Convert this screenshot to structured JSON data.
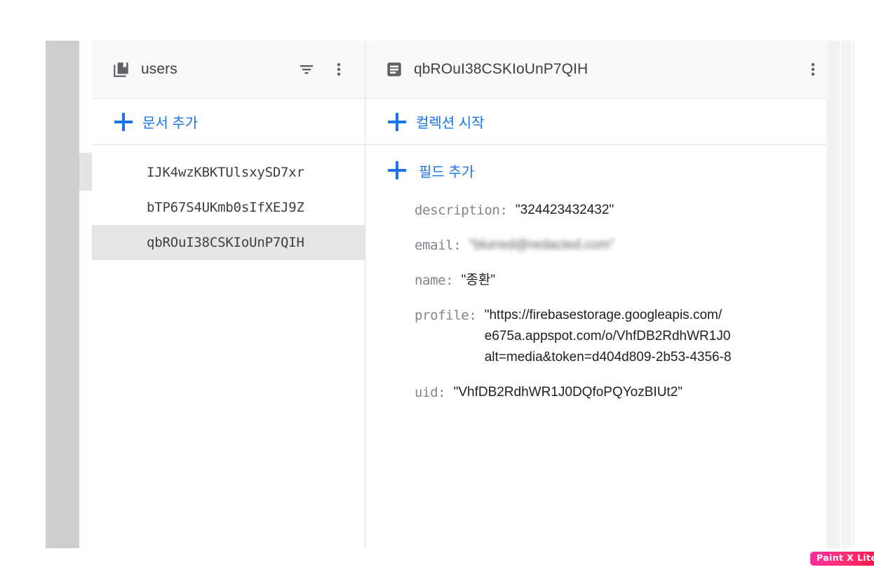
{
  "app": {
    "product": "Firebase Firestore Data Viewer"
  },
  "collection_panel": {
    "icon": "collection-icon",
    "title": "users",
    "filter_icon": "filter-sort-icon",
    "more_icon": "more-vert-icon",
    "add_document": {
      "icon": "plus-icon",
      "label": "문서 추가"
    },
    "documents": [
      {
        "id": "IJK4wzKBKTUlsxySD7xr",
        "selected": false
      },
      {
        "id": "bTP67S4UKmb0sIfXEJ9Z",
        "selected": false
      },
      {
        "id": "qbROuI38CSKIoUnP7QIH",
        "selected": true
      }
    ]
  },
  "document_panel": {
    "icon": "document-icon",
    "title": "qbROuI38CSKIoUnP7QIH",
    "more_icon": "more-vert-icon",
    "start_collection": {
      "icon": "plus-icon",
      "label": "컬렉션 시작"
    },
    "add_field": {
      "icon": "plus-icon",
      "label": "필드 추가"
    },
    "fields": [
      {
        "key": "description",
        "value": "\"324423432432\"",
        "redacted": false,
        "multiline": false
      },
      {
        "key": "email",
        "value": "\"blurred@redacted.com\"",
        "redacted": true,
        "multiline": false
      },
      {
        "key": "name",
        "value": "\"종환\"",
        "redacted": false,
        "multiline": false
      },
      {
        "key": "profile",
        "redacted": false,
        "multiline": true,
        "lines": [
          "\"https://firebasestorage.googleapis.com/",
          "e675a.appspot.com/o/VhfDB2RdhWR1J0",
          "alt=media&token=d404d809-2b53-4356-8"
        ]
      },
      {
        "key": "uid",
        "value": "\"VhfDB2RdhWR1J0DQfoPQYozBIUt2\"",
        "redacted": false,
        "multiline": false
      }
    ]
  },
  "watermark": {
    "label": "Paint X Lite"
  },
  "colors": {
    "accent_blue": "#1a73e8",
    "header_bg": "#f9f9f9",
    "selected_row": "#e6e6e6",
    "key_text": "#80868b",
    "value_text": "#202124",
    "divider": "#e3e3e3"
  }
}
